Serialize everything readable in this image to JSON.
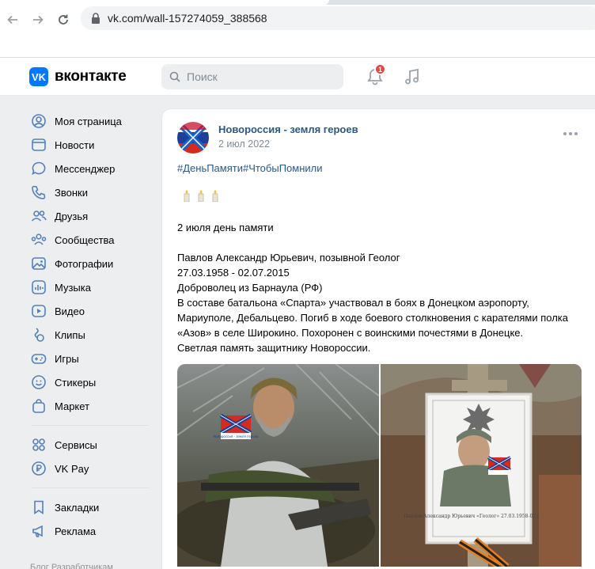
{
  "browser": {
    "url": "vk.com/wall-157274059_388568"
  },
  "header": {
    "logo_text": "вконтакте",
    "logo_letters": "VK",
    "search_placeholder": "Поиск",
    "notification_count": "1",
    "accent": "#0077ff"
  },
  "menu": {
    "items": [
      {
        "label": "Моя страница",
        "icon": "user-circle-icon"
      },
      {
        "label": "Новости",
        "icon": "newspaper-icon"
      },
      {
        "label": "Мессенджер",
        "icon": "chat-bubble-icon"
      },
      {
        "label": "Звонки",
        "icon": "phone-icon"
      },
      {
        "label": "Друзья",
        "icon": "friends-icon"
      },
      {
        "label": "Сообщества",
        "icon": "communities-icon"
      },
      {
        "label": "Фотографии",
        "icon": "photo-icon"
      },
      {
        "label": "Музыка",
        "icon": "music-icon"
      },
      {
        "label": "Видео",
        "icon": "video-icon"
      },
      {
        "label": "Клипы",
        "icon": "clips-icon"
      },
      {
        "label": "Игры",
        "icon": "gamepad-icon"
      },
      {
        "label": "Стикеры",
        "icon": "sticker-icon"
      },
      {
        "label": "Маркет",
        "icon": "market-bag-icon"
      }
    ],
    "items2": [
      {
        "label": "Сервисы",
        "icon": "services-grid-icon"
      },
      {
        "label": "VK Pay",
        "icon": "vkpay-icon"
      }
    ],
    "items3": [
      {
        "label": "Закладки",
        "icon": "bookmark-icon"
      },
      {
        "label": "Реклама",
        "icon": "megaphone-icon"
      }
    ],
    "footer": "Блог   Разработчикам"
  },
  "post": {
    "group_name": "Новороссия - земля героев",
    "date": "2 июл 2022",
    "hashtags": "#ДеньПамяти#ЧтобыПомнили",
    "candles": "🕯🕯🕯",
    "lines": [
      "2 июля день памяти",
      "Павлов Александр Юрьевич, позывной Геолог",
      "27.03.1958 - 02.07.2015",
      "Доброволец из Барнаула (РФ)",
      "В составе батальона «Спарта» участвовал в боях в Донецком аэропорту,",
      "Мариуполе, Дебальцево. Погиб в ходе боевого столкновения с карателями полка",
      "«Азов» в селе Широкино. Похоронен с воинскими почестями в Донецке.",
      "Светлая память защитнику Новороссии."
    ],
    "flag_caption": "Новороссия - земля героев",
    "memorial_plate_text": "Павлов Александр Юрьевич «Геолог» 27.03.1958-02.07.2015"
  }
}
